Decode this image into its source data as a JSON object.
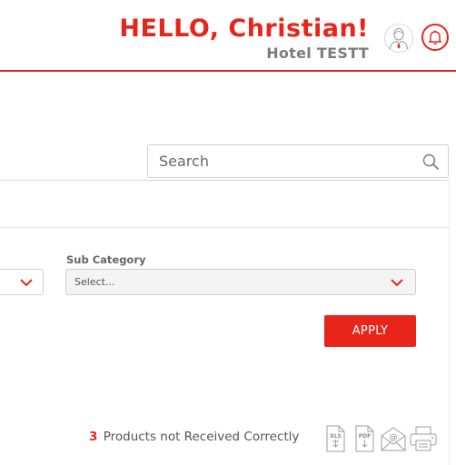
{
  "header": {
    "greeting": "HELLO, Christian!",
    "hotel": "Hotel TESTT",
    "avatar_icon": "user-avatar-icon",
    "notification_icon": "bell-icon"
  },
  "search": {
    "placeholder": "Search",
    "icon": "search-icon"
  },
  "filters": {
    "sub_category_label": "Sub Category",
    "sub_category_value": "Select..."
  },
  "actions": {
    "apply_label": "APPLY"
  },
  "status": {
    "count": "3",
    "text": "Products not Received Correctly"
  },
  "export_tools": [
    {
      "name": "xls-export-icon",
      "label": "XLS"
    },
    {
      "name": "pdf-export-icon",
      "label": "PDF"
    },
    {
      "name": "email-icon",
      "label": "@"
    },
    {
      "name": "print-icon",
      "label": ""
    }
  ],
  "colors": {
    "accent": "#e8251b",
    "muted_text": "#7b7b7b",
    "border": "#cfcfcf"
  }
}
